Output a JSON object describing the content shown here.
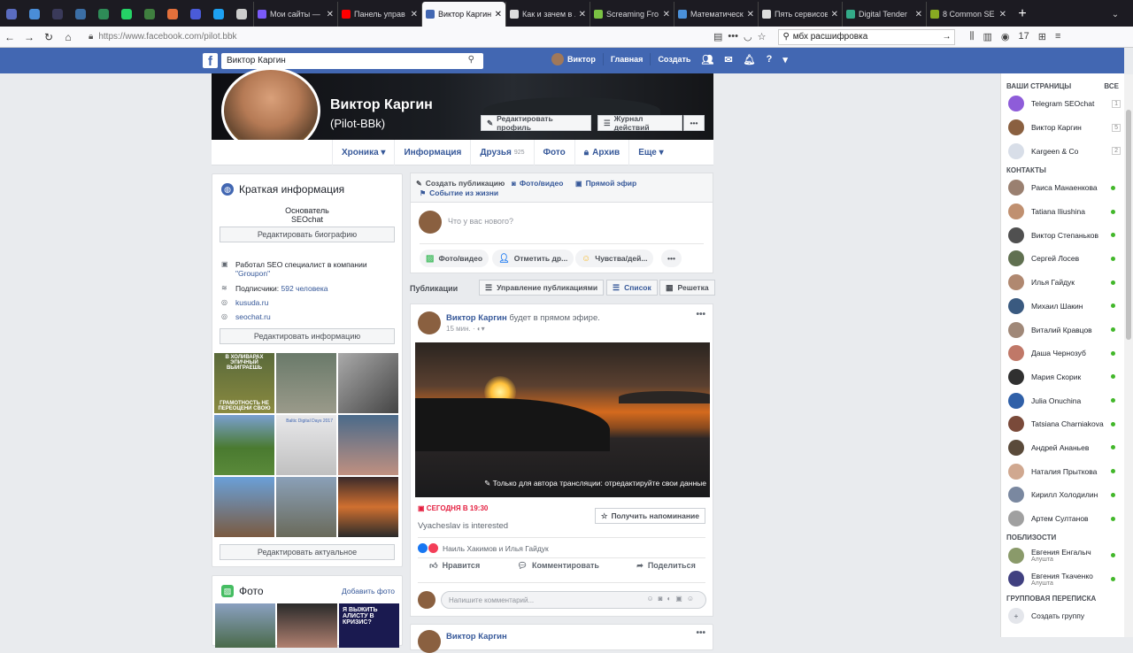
{
  "browser": {
    "pinned_colors": [
      "#5a6cc0",
      "#4a8dd8",
      "#3a3a5a",
      "#3b6ea5",
      "#2e8b57",
      "#25d366",
      "#3f7f3f",
      "#e3703b",
      "#4a5bd8",
      "#1da1f2",
      "#cccccc"
    ],
    "tabs": [
      {
        "label": "Мои сайты —",
        "fav": "#7a5af8",
        "active": false
      },
      {
        "label": "Панель управ",
        "fav": "#ff0000",
        "active": false
      },
      {
        "label": "Виктор Каргин",
        "fav": "#4267b2",
        "active": true
      },
      {
        "label": "Как и зачем в ...",
        "fav": "#dddddd",
        "active": false
      },
      {
        "label": "Screaming Fro",
        "fav": "#7ac143",
        "active": false
      },
      {
        "label": "Математическ",
        "fav": "#4a90d9",
        "active": false
      },
      {
        "label": "Пять сервисов",
        "fav": "#dddddd",
        "active": false
      },
      {
        "label": "Digital Tender",
        "fav": "#33aa88",
        "active": false
      },
      {
        "label": "8 Common SE",
        "fav": "#88aa22",
        "active": false
      }
    ],
    "url": "https://www.facebook.com/pilot.bbk",
    "search_text": "мбх расшифровка",
    "profile_count": "17"
  },
  "fb": {
    "search_value": "Виктор Каргин",
    "user_name": "Виктор",
    "home": "Главная",
    "create": "Создать"
  },
  "profile": {
    "name": "Виктор Каргин",
    "nickname": "(Pilot-BBk)",
    "edit_profile": "Редактировать профиль",
    "activity_log": "Журнал действий",
    "tabs": {
      "chronicle": "Хроника",
      "info": "Информация",
      "friends": "Друзья",
      "friends_count": "925",
      "photos": "Фото",
      "archive": "Архив",
      "more": "Еще"
    }
  },
  "intro": {
    "title": "Краткая информация",
    "role": "Основатель",
    "company": "SEOchat",
    "edit_bio": "Редактировать биографию",
    "work_pre": "Работал SEO специалист в компании",
    "work_company": "\"Groupon\"",
    "followers_label": "Подписчики:",
    "followers_value": "592 человека",
    "site1": "kusuda.ru",
    "site2": "seochat.ru",
    "edit_info": "Редактировать информацию",
    "edit_featured": "Редактировать актуальное",
    "photo_captions": {
      "meme_top": "В ХОЛИВАРАХ ЭПИЧНЫЙ ВЫИГРАЕШЬ",
      "meme_bottom": "ГРАМОТНОСТЬ НЕ ПЕРЕОЦЕНИ СВОЮ",
      "event": "Baltic Digital Days 2017"
    }
  },
  "photos_card": {
    "title": "Фото",
    "add": "Добавить фото",
    "thumb_text": "Я ВЫЖИТЬ АЛИСТУ В КРИЗИС?"
  },
  "composer": {
    "create_post": "Создать публикацию",
    "photo_video": "Фото/видео",
    "live": "Прямой эфир",
    "life_event": "Событие из жизни",
    "placeholder": "Что у вас нового?",
    "btn_photo": "Фото/видео",
    "btn_tag": "Отметить др...",
    "btn_feeling": "Чувства/дей...",
    "btn_more": "•••"
  },
  "publications": {
    "label": "Публикации",
    "manage": "Управление публикациями",
    "list": "Список",
    "grid": "Решетка"
  },
  "post": {
    "author": "Виктор Каргин",
    "action": "будет в прямом эфире.",
    "time": "15 мин.",
    "video_caption": "Только для автора трансляции: отредактируйте свои данные",
    "live_when": "СЕГОДНЯ В 19:30",
    "interested": "Vyacheslav is interested",
    "remind": "Получить напоминание",
    "reactions": "Наиль Хакимов и Илья Гайдук",
    "like": "Нравится",
    "comment": "Комментировать",
    "share": "Поделиться",
    "comment_placeholder": "Напишите комментарий..."
  },
  "next_post_author": "Виктор Каргин",
  "right_panel": {
    "pages_title": "ВАШИ СТРАНИЦЫ",
    "pages_all": "ВСЕ",
    "pages": [
      {
        "name": "Telegram SEOchat",
        "count": "1",
        "color": "#8e5cd9"
      },
      {
        "name": "Виктор Каргин",
        "count": "5",
        "color": "#8a6040"
      },
      {
        "name": "Kargeen & Co",
        "count": "2",
        "color": "#d8dee8"
      }
    ],
    "contacts_title": "КОНТАКТЫ",
    "contacts": [
      {
        "name": "Раиса Манаенкова",
        "color": "#9a8070"
      },
      {
        "name": "Tatiana Iliushina",
        "color": "#c09070"
      },
      {
        "name": "Виктор Степаньков",
        "color": "#505050"
      },
      {
        "name": "Сергей Лосев",
        "color": "#607050"
      },
      {
        "name": "Илья Гайдук",
        "color": "#b08870"
      },
      {
        "name": "Михаил Шакин",
        "color": "#3a5a80"
      },
      {
        "name": "Виталий Кравцов",
        "color": "#a08878"
      },
      {
        "name": "Даша Чернозуб",
        "color": "#c07868"
      },
      {
        "name": "Мария Скорик",
        "color": "#303030"
      },
      {
        "name": "Julia Onuchina",
        "color": "#3060a8"
      },
      {
        "name": "Tatsiana Charniakova",
        "color": "#7a4a3a"
      },
      {
        "name": "Андрей Ананьев",
        "color": "#5a4a3a"
      },
      {
        "name": "Наталия Прыткова",
        "color": "#d0a890"
      },
      {
        "name": "Кирилл Холодилин",
        "color": "#7a88a0"
      },
      {
        "name": "Артем Султанов",
        "color": "#a0a0a0"
      }
    ],
    "nearby_title": "ПОБЛИЗОСТИ",
    "nearby": [
      {
        "name": "Евгения Енгалыч",
        "sub": "Алушта",
        "color": "#8a9a6a"
      },
      {
        "name": "Евгения Ткаченко",
        "sub": "Алушта",
        "color": "#404080"
      }
    ],
    "group_title": "ГРУППОВАЯ ПЕРЕПИСКА",
    "create_group": "Создать группу"
  }
}
